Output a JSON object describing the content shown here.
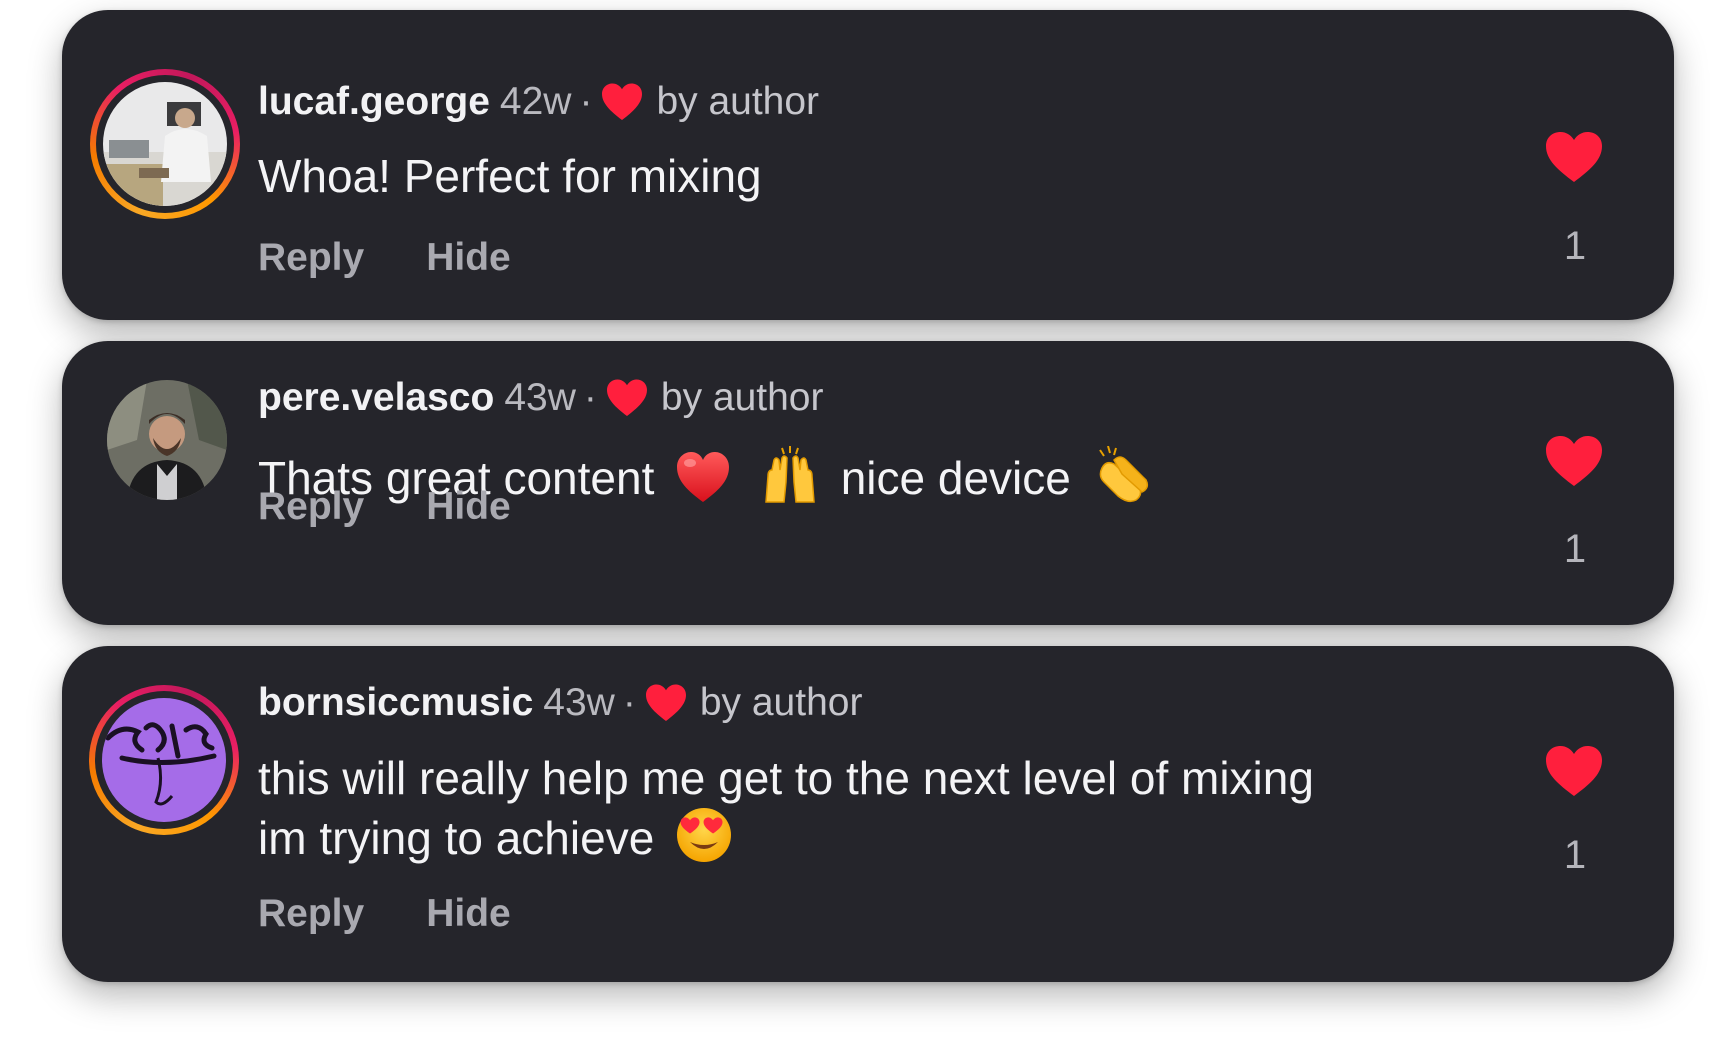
{
  "colors": {
    "card_bg": "#25252b",
    "heart_red": "#ff1f3d",
    "username": "#f2f2f4",
    "muted": "#b9b9bf",
    "story_ring": [
      "#f9a825",
      "#e91e63"
    ]
  },
  "comments": [
    {
      "username": "lucaf.george",
      "age": "42w",
      "separator": "·",
      "liked_by_label": "by author",
      "text": "Whoa! Perfect for mixing",
      "reply_label": "Reply",
      "hide_label": "Hide",
      "like_count": "1",
      "has_story_ring": true,
      "avatar_icon": "user-photo-avatar"
    },
    {
      "username": "pere.velasco",
      "age": "43w",
      "separator": "·",
      "liked_by_label": "by author",
      "text_part1": "Thats great content",
      "text_part2": "nice device",
      "emojis": [
        "red-heart-emoji",
        "raising-hands-emoji",
        "clapping-hands-emoji"
      ],
      "reply_label": "Reply",
      "hide_label": "Hide",
      "like_count": "1",
      "has_story_ring": false,
      "avatar_icon": "user-photo-avatar"
    },
    {
      "username": "bornsiccmusic",
      "age": "43w",
      "separator": "·",
      "liked_by_label": "by author",
      "text_line1": "this will really help me get to the next level of mixing",
      "text_line2": "im trying to achieve",
      "emojis": [
        "heart-eyes-emoji"
      ],
      "reply_label": "Reply",
      "hide_label": "Hide",
      "like_count": "1",
      "has_story_ring": true,
      "avatar_icon": "purple-logo-avatar"
    }
  ]
}
